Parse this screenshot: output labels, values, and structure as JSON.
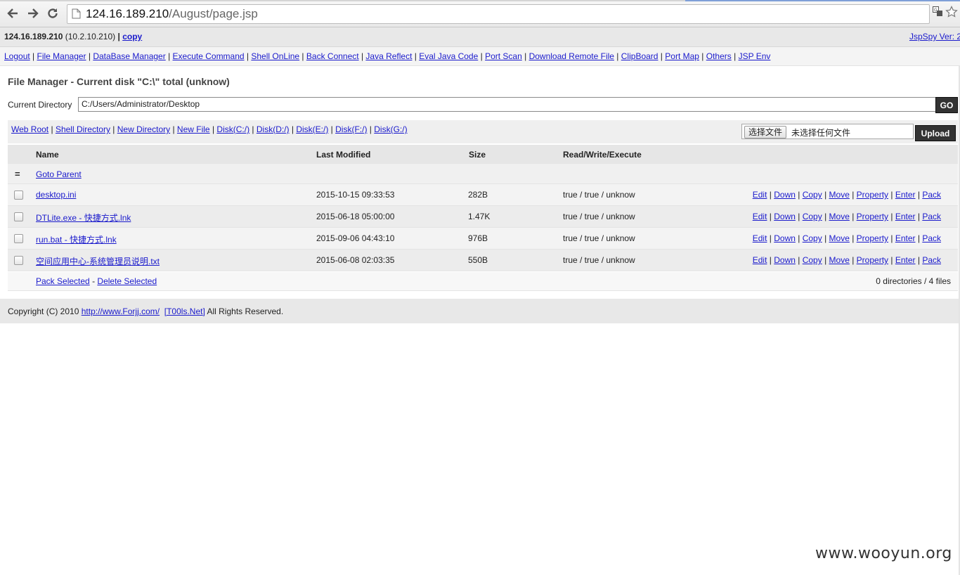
{
  "browser": {
    "url_host": "124.16.189.210",
    "url_path": "/August/page.jsp"
  },
  "info": {
    "ip": "124.16.189.210",
    "local_ip": "(10.2.10.210)",
    "sep": "|",
    "copy": "copy",
    "version": "JspSpy Ver: 2"
  },
  "menu": [
    "Logout",
    "File Manager",
    "DataBase Manager",
    "Execute Command",
    "Shell OnLine",
    "Back Connect",
    "Java Reflect",
    "Eval Java Code",
    "Port Scan",
    "Download Remote File",
    "ClipBoard",
    "Port Map",
    "Others",
    "JSP Env"
  ],
  "heading": "File Manager - Current disk \"C:\\\" total (unknow)",
  "current_directory": {
    "label": "Current Directory",
    "value": "C:/Users/Administrator/Desktop",
    "go": "GO"
  },
  "toolbar": {
    "links": [
      "Web Root",
      "Shell Directory",
      "New Directory",
      "New File",
      "Disk(C:/)",
      "Disk(D:/)",
      "Disk(E:/)",
      "Disk(F:/)",
      "Disk(G:/)"
    ],
    "choose_file": "选择文件",
    "no_file": "未选择任何文件",
    "upload": "Upload"
  },
  "table": {
    "headers": {
      "name": "Name",
      "modified": "Last Modified",
      "size": "Size",
      "rwx": "Read/Write/Execute"
    },
    "parent_icon": "=",
    "goto_parent": "Goto Parent",
    "actions": [
      "Edit",
      "Down",
      "Copy",
      "Move",
      "Property",
      "Enter",
      "Pack"
    ],
    "files": [
      {
        "name": "desktop.ini",
        "modified": "2015-10-15 09:33:53",
        "size": "282B",
        "rwx": "true / true / unknow"
      },
      {
        "name": "DTLite.exe - 快捷方式.lnk",
        "modified": "2015-06-18 05:00:00",
        "size": "1.47K",
        "rwx": "true / true / unknow"
      },
      {
        "name": "run.bat - 快捷方式.lnk",
        "modified": "2015-09-06 04:43:10",
        "size": "976B",
        "rwx": "true / true / unknow"
      },
      {
        "name": "空间应用中心-系统管理员说明.txt",
        "modified": "2015-06-08 02:03:35",
        "size": "550B",
        "rwx": "true / true / unknow"
      }
    ],
    "pack_selected": "Pack Selected",
    "dash": "-",
    "delete_selected": "Delete Selected",
    "summary": "0 directories / 4 files"
  },
  "copyright": {
    "prefix": "Copyright (C) 2010",
    "link1": "http://www.Forjj.com/",
    "link2": "[T00ls.Net]",
    "suffix": "All Rights Reserved."
  },
  "watermark": "www.wooyun.org"
}
